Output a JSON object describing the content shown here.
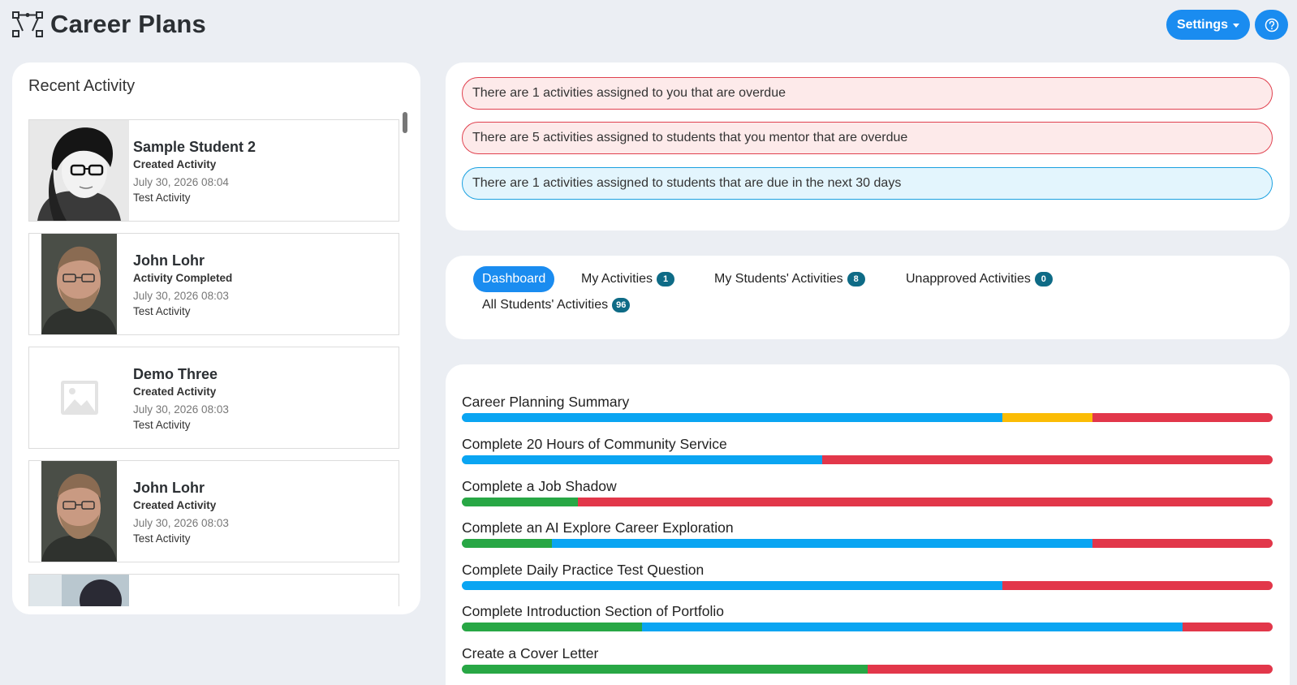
{
  "header": {
    "title": "Career Plans",
    "settings_label": "Settings",
    "app_icon": "vector-path-icon",
    "help_icon": "help-circle-icon"
  },
  "recent": {
    "title": "Recent Activity",
    "items": [
      {
        "name": "Sample Student 2",
        "action": "Created Activity",
        "time": "July 30, 2026 08:04",
        "desc": "Test Activity",
        "photo": "sample-student-photo"
      },
      {
        "name": "John Lohr",
        "action": "Activity Completed",
        "time": "July 30, 2026 08:03",
        "desc": "Test Activity",
        "photo": "john-lohr-photo"
      },
      {
        "name": "Demo Three",
        "action": "Created Activity",
        "time": "July 30, 2026 08:03",
        "desc": "Test Activity",
        "photo": "image-placeholder-icon"
      },
      {
        "name": "John Lohr",
        "action": "Created Activity",
        "time": "July 30, 2026 08:03",
        "desc": "Test Activity",
        "photo": "john-lohr-photo"
      }
    ]
  },
  "alerts": [
    {
      "text": "There are 1 activities assigned to you that are overdue",
      "type": "danger"
    },
    {
      "text": "There are 5 activities assigned to students that you mentor that are overdue",
      "type": "danger"
    },
    {
      "text": "There are 1 activities assigned to students that are due in the next 30 days",
      "type": "info"
    }
  ],
  "tabs": [
    {
      "label": "Dashboard",
      "active": true
    },
    {
      "label": "My Activities",
      "count": "1"
    },
    {
      "label": "My Students' Activities",
      "count": "8"
    },
    {
      "label": "Unapproved Activities",
      "count": "0"
    },
    {
      "label": "All Students' Activities",
      "count": "96"
    }
  ],
  "colors": {
    "completed": "#28a745",
    "in_progress": "#0aa5f2",
    "pending": "#fbbc05",
    "overdue": "#e2374a",
    "accent": "#1a8cf0"
  },
  "plans": [
    {
      "label": "Career Planning Summary",
      "segments": [
        {
          "status": "in_progress",
          "fraction": 0.667
        },
        {
          "status": "pending",
          "fraction": 0.111
        },
        {
          "status": "overdue",
          "fraction": 0.222
        }
      ]
    },
    {
      "label": "Complete 20 Hours of Community Service",
      "segments": [
        {
          "status": "in_progress",
          "fraction": 0.444
        },
        {
          "status": "overdue",
          "fraction": 0.556
        }
      ]
    },
    {
      "label": "Complete a Job Shadow",
      "segments": [
        {
          "status": "completed",
          "fraction": 0.143
        },
        {
          "status": "overdue",
          "fraction": 0.857
        }
      ]
    },
    {
      "label": "Complete an AI Explore Career Exploration",
      "segments": [
        {
          "status": "completed",
          "fraction": 0.111
        },
        {
          "status": "in_progress",
          "fraction": 0.667
        },
        {
          "status": "overdue",
          "fraction": 0.222
        }
      ]
    },
    {
      "label": "Complete Daily Practice Test Question",
      "segments": [
        {
          "status": "in_progress",
          "fraction": 0.667
        },
        {
          "status": "overdue",
          "fraction": 0.333
        }
      ]
    },
    {
      "label": "Complete Introduction Section of Portfolio",
      "segments": [
        {
          "status": "completed",
          "fraction": 0.222
        },
        {
          "status": "in_progress",
          "fraction": 0.667
        },
        {
          "status": "overdue",
          "fraction": 0.111
        }
      ]
    },
    {
      "label": "Create a Cover Letter",
      "segments": [
        {
          "status": "completed",
          "fraction": 0.5
        },
        {
          "status": "overdue",
          "fraction": 0.5
        }
      ]
    }
  ]
}
